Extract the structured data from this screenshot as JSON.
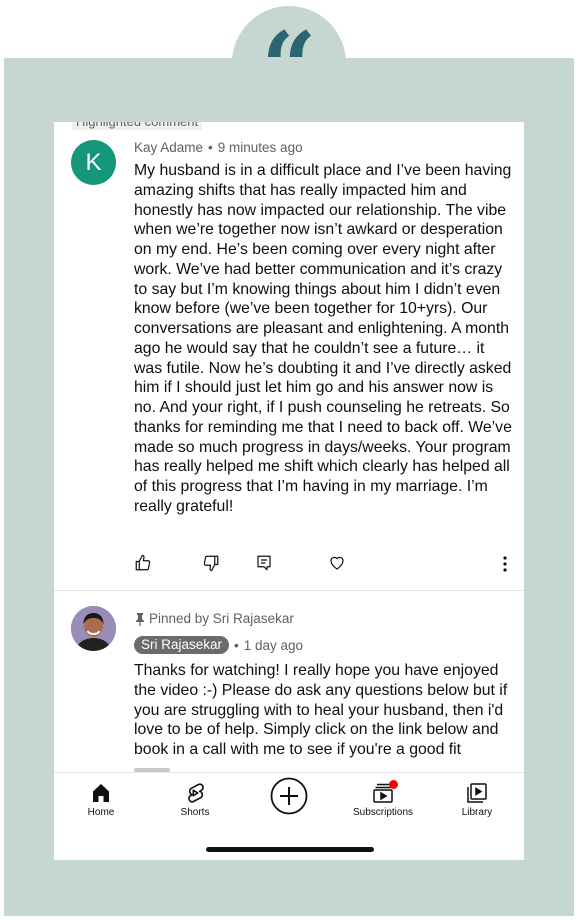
{
  "decoration": {
    "quote_glyph": "“"
  },
  "highlighted": {
    "label": "Highlighted comment",
    "avatar_letter": "K",
    "author": "Kay Adame",
    "separator": "•",
    "time": "9 minutes ago",
    "text": "My husband is in a difficult place and I’ve been having amazing shifts that has really impacted him and honestly has now impacted our relationship. The vibe when we’re together now isn’t awkard or desperation on my end. He’s been coming over every night after work. We’ve had better communication and it’s crazy to say but I’m knowing things about him I didn’t even know before (we’ve been together for 10+yrs). Our conversations are pleasant and enlightening. A month ago he would say that he couldn’t see a future… it was futile. Now he’s doubting it and I’ve directly asked him if I should just let him go and his answer now is no. And your right, if I push counseling he retreats. So thanks for reminding me that I need to back off. We’ve made so much progress in days/weeks. Your program has really helped me shift which clearly has helped all of this progress that I’m having in my marriage. I’m really grateful!",
    "actions": [
      "like-icon",
      "dislike-icon",
      "reply-icon",
      "heart-icon",
      "more-vertical-icon"
    ]
  },
  "pinned_comment": {
    "pinned_label": "Pinned by Sri Rajasekar",
    "author": "Sri Rajasekar",
    "separator": "•",
    "time": "1 day ago",
    "text": "Thanks for watching!  I really hope you have enjoyed the video :-) Please do ask any questions below but if you are struggling with to heal your husband, then i'd love to be of help.  Simply click on the link below and book in a call with me to see if you're a good fit"
  },
  "bottom_nav": {
    "items": [
      {
        "label": "Home",
        "icon": "home-icon"
      },
      {
        "label": "Shorts",
        "icon": "shorts-icon"
      },
      {
        "label": "",
        "icon": "create-plus-icon"
      },
      {
        "label": "Subscriptions",
        "icon": "subscriptions-icon"
      },
      {
        "label": "Library",
        "icon": "library-icon"
      }
    ]
  },
  "colors": {
    "frame": "#c6d6d0",
    "quote": "#2a6571",
    "avatar_k": "#14977a",
    "author_chip": "#6b6b6b",
    "notification": "#ff0000"
  }
}
